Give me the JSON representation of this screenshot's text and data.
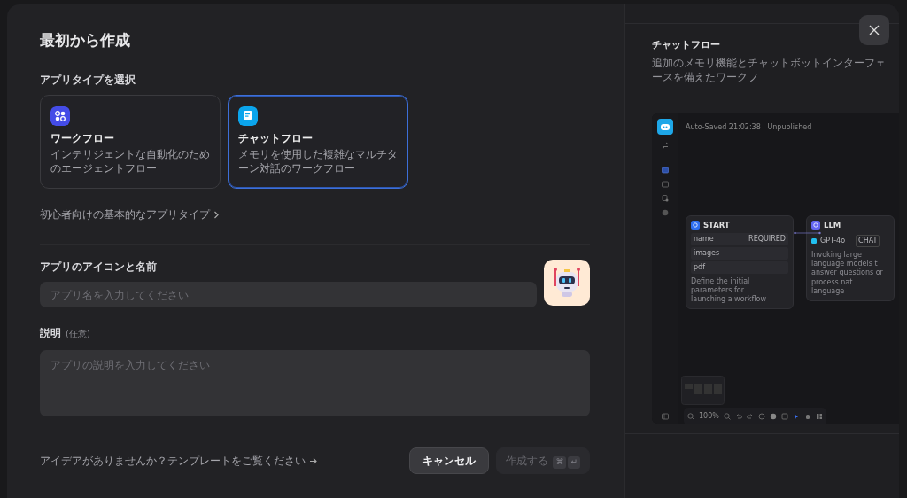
{
  "dialog": {
    "title": "最初から作成"
  },
  "app_type": {
    "label": "アプリタイプを選択",
    "options": [
      {
        "kind": "workflow",
        "title": "ワークフロー",
        "description": "インテリジェントな自動化のためのエージェントフロー",
        "color": "#444ce7",
        "selected": false
      },
      {
        "kind": "chatflow",
        "title": "チャットフロー",
        "description": "メモリを使用した複雑なマルチターン対話のワークフロー",
        "color": "#0ba5ec",
        "selected": true
      }
    ]
  },
  "beginner_link": "初心者向けの基本的なアプリタイプ",
  "name_field": {
    "label": "アプリのアイコンと名前",
    "placeholder": "アプリ名を入力してください"
  },
  "description_field": {
    "label": "説明",
    "optional": "(任意)",
    "placeholder": "アプリの説明を入力してください"
  },
  "template_link": "アイデアがありませんか？テンプレートをご覧ください",
  "buttons": [
    {
      "label": "キャンセル",
      "disabled": false
    },
    {
      "label": "作成する",
      "disabled": true,
      "shortcut": [
        "⌘",
        "↵"
      ]
    }
  ],
  "preview": {
    "title": "チャットフロー",
    "description": "追加のメモリ機能とチャットボットインターフェースを備えたワークフ",
    "canvas": {
      "status": "Auto-Saved 21:02:38 · Unpublished",
      "zoom": "100%",
      "nodes": [
        {
          "kind": "start",
          "title": "START",
          "fields": [
            {
              "name": "name",
              "tag": "REQUIRED"
            },
            {
              "name": "images"
            },
            {
              "name": "pdf"
            }
          ],
          "description": [
            "Define the initial parameters for",
            "launching a workflow"
          ]
        },
        {
          "kind": "llm",
          "title": "LLM",
          "model": "GPT-4o",
          "tag": "CHAT",
          "description": [
            "Invoking large language models t",
            "answer questions or process nat",
            "language"
          ]
        }
      ]
    }
  }
}
